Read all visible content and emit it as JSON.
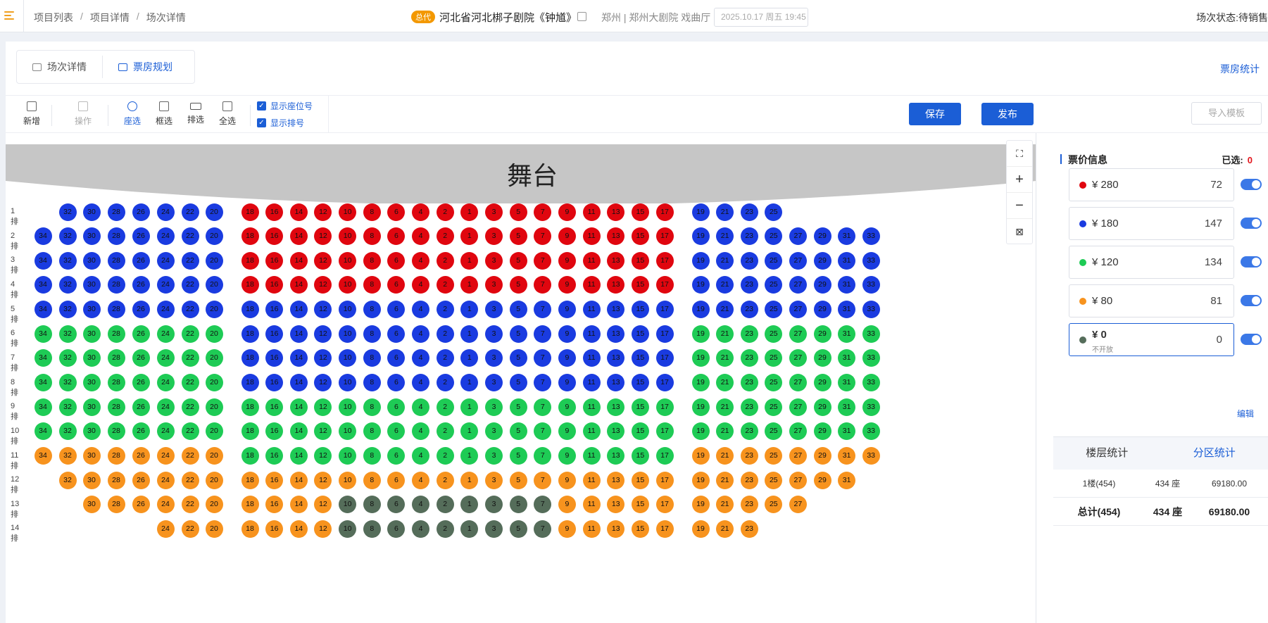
{
  "header": {
    "breadcrumb": [
      "项目列表",
      "项目详情",
      "场次详情"
    ],
    "badge": "总代",
    "show_title": "河北省河北梆子剧院《钟馗》",
    "venue": "郑州 | 郑州大剧院 戏曲厅",
    "datetime": "2025.10.17 周五 19:45",
    "status": "场次状态:待销售"
  },
  "tabs": {
    "detail": "场次详情",
    "plan": "票房规划"
  },
  "box_office_stats_link": "票房统计",
  "toolbar": {
    "add": "新增",
    "operate": "操作",
    "seat_select": "座选",
    "box_select": "框选",
    "row_select": "排选",
    "select_all": "全选",
    "show_seat_number": "显示座位号",
    "show_row_number": "显示排号",
    "save": "保存",
    "publish": "发布",
    "import_template": "导入模板"
  },
  "stage": {
    "label": "舞台"
  },
  "zoom": {
    "fit": "⛶",
    "plus": "+",
    "minus": "−",
    "reset": "⊠"
  },
  "colors": {
    "red": "#e0060f",
    "blue": "#1a3be0",
    "green": "#1ecb55",
    "orange": "#f7931e",
    "gray": "#556d5a"
  },
  "seat_map": {
    "left_side": [
      "34",
      "32",
      "30",
      "28",
      "26",
      "24",
      "22",
      "20"
    ],
    "center": [
      "18",
      "16",
      "14",
      "12",
      "10",
      "8",
      "6",
      "4",
      "2",
      "1",
      "3",
      "5",
      "7",
      "9",
      "11",
      "13",
      "15",
      "17"
    ],
    "right_side": [
      "19",
      "21",
      "23",
      "25",
      "27",
      "29",
      "31",
      "33"
    ],
    "rows": [
      {
        "label": "1排",
        "L": [
          "",
          "b",
          "b",
          "b",
          "b",
          "b",
          "b",
          "b"
        ],
        "C": "rrrrrrrrrrrrrrrrrr",
        "R": [
          "b",
          "b",
          "b",
          "b",
          "",
          "",
          "",
          ""
        ]
      },
      {
        "label": "2排",
        "L": [
          "b",
          "b",
          "b",
          "b",
          "b",
          "b",
          "b",
          "b"
        ],
        "C": "rrrrrrrrrrrrrrrrrr",
        "R": [
          "b",
          "b",
          "b",
          "b",
          "b",
          "b",
          "b",
          "b"
        ]
      },
      {
        "label": "3排",
        "L": [
          "b",
          "b",
          "b",
          "b",
          "b",
          "b",
          "b",
          "b"
        ],
        "C": "rrrrrrrrrrrrrrrrrr",
        "R": [
          "b",
          "b",
          "b",
          "b",
          "b",
          "b",
          "b",
          "b"
        ]
      },
      {
        "label": "4排",
        "L": [
          "b",
          "b",
          "b",
          "b",
          "b",
          "b",
          "b",
          "b"
        ],
        "C": "rrrrrrrrrrrrrrrrrr",
        "R": [
          "b",
          "b",
          "b",
          "b",
          "b",
          "b",
          "b",
          "b"
        ]
      },
      {
        "label": "5排",
        "L": [
          "b",
          "b",
          "b",
          "b",
          "b",
          "b",
          "b",
          "b"
        ],
        "C": "bbbbbbbbbbbbbbbbbb",
        "R": [
          "b",
          "b",
          "b",
          "b",
          "b",
          "b",
          "b",
          "b"
        ]
      },
      {
        "label": "6排",
        "L": [
          "g",
          "g",
          "g",
          "g",
          "g",
          "g",
          "g",
          "g"
        ],
        "C": "bbbbbbbbbbbbbbbbbb",
        "R": [
          "g",
          "g",
          "g",
          "g",
          "g",
          "g",
          "g",
          "g"
        ]
      },
      {
        "label": "7排",
        "L": [
          "g",
          "g",
          "g",
          "g",
          "g",
          "g",
          "g",
          "g"
        ],
        "C": "bbbbbbbbbbbbbbbbbb",
        "R": [
          "g",
          "g",
          "g",
          "g",
          "g",
          "g",
          "g",
          "g"
        ]
      },
      {
        "label": "8排",
        "L": [
          "g",
          "g",
          "g",
          "g",
          "g",
          "g",
          "g",
          "g"
        ],
        "C": "bbbbbbbbbbbbbbbbbb",
        "R": [
          "g",
          "g",
          "g",
          "g",
          "g",
          "g",
          "g",
          "g"
        ]
      },
      {
        "label": "9排",
        "L": [
          "g",
          "g",
          "g",
          "g",
          "g",
          "g",
          "g",
          "g"
        ],
        "C": "gggggggggggggggggg",
        "R": [
          "g",
          "g",
          "g",
          "g",
          "g",
          "g",
          "g",
          "g"
        ]
      },
      {
        "label": "10排",
        "L": [
          "g",
          "g",
          "g",
          "g",
          "g",
          "g",
          "g",
          "g"
        ],
        "C": "gggggggggggggggggg",
        "R": [
          "g",
          "g",
          "g",
          "g",
          "g",
          "g",
          "g",
          "g"
        ]
      },
      {
        "label": "11排",
        "L": [
          "o",
          "o",
          "o",
          "o",
          "o",
          "o",
          "o",
          "o"
        ],
        "C": "gggggggggggggggggg",
        "R": [
          "o",
          "o",
          "o",
          "o",
          "o",
          "o",
          "o",
          "o"
        ]
      },
      {
        "label": "12排",
        "L": [
          "",
          "o",
          "o",
          "o",
          "o",
          "o",
          "o",
          "o"
        ],
        "C": "oooooooooooooooooo",
        "R": [
          "o",
          "o",
          "o",
          "o",
          "o",
          "o",
          "o",
          ""
        ]
      },
      {
        "label": "13排",
        "L": [
          "",
          "",
          "o",
          "o",
          "o",
          "o",
          "o",
          "o"
        ],
        "C": "ooookkkkkkkkkooooo",
        "R": [
          "o",
          "o",
          "o",
          "o",
          "o",
          "",
          "",
          ""
        ]
      },
      {
        "label": "14排",
        "L": [
          "",
          "",
          "",
          "",
          "",
          "o",
          "o",
          "o"
        ],
        "C": "ooookkkkkkkkkooooo",
        "R": [
          "o",
          "o",
          "o",
          "",
          "",
          "",
          "",
          ""
        ]
      }
    ]
  },
  "price_panel": {
    "title": "票价信息",
    "selected_label": "已选:",
    "selected_count": "0",
    "items": [
      {
        "price": "¥ 280",
        "count": "72",
        "color": "#e0060f"
      },
      {
        "price": "¥ 180",
        "count": "147",
        "color": "#1a3be0"
      },
      {
        "price": "¥ 120",
        "count": "134",
        "color": "#1ecb55"
      },
      {
        "price": "¥ 80",
        "count": "81",
        "color": "#f7931e"
      },
      {
        "price": "¥ 0",
        "count": "0",
        "color": "#556d5a",
        "sub": "不开放"
      }
    ],
    "edit": "编辑"
  },
  "stats": {
    "tab_floor": "楼层统计",
    "tab_zone": "分区统计",
    "rows": [
      {
        "name": "1楼(454)",
        "seats": "434 座",
        "amount": "69180.00"
      },
      {
        "name": "总计(454)",
        "seats": "434 座",
        "amount": "69180.00"
      }
    ]
  }
}
